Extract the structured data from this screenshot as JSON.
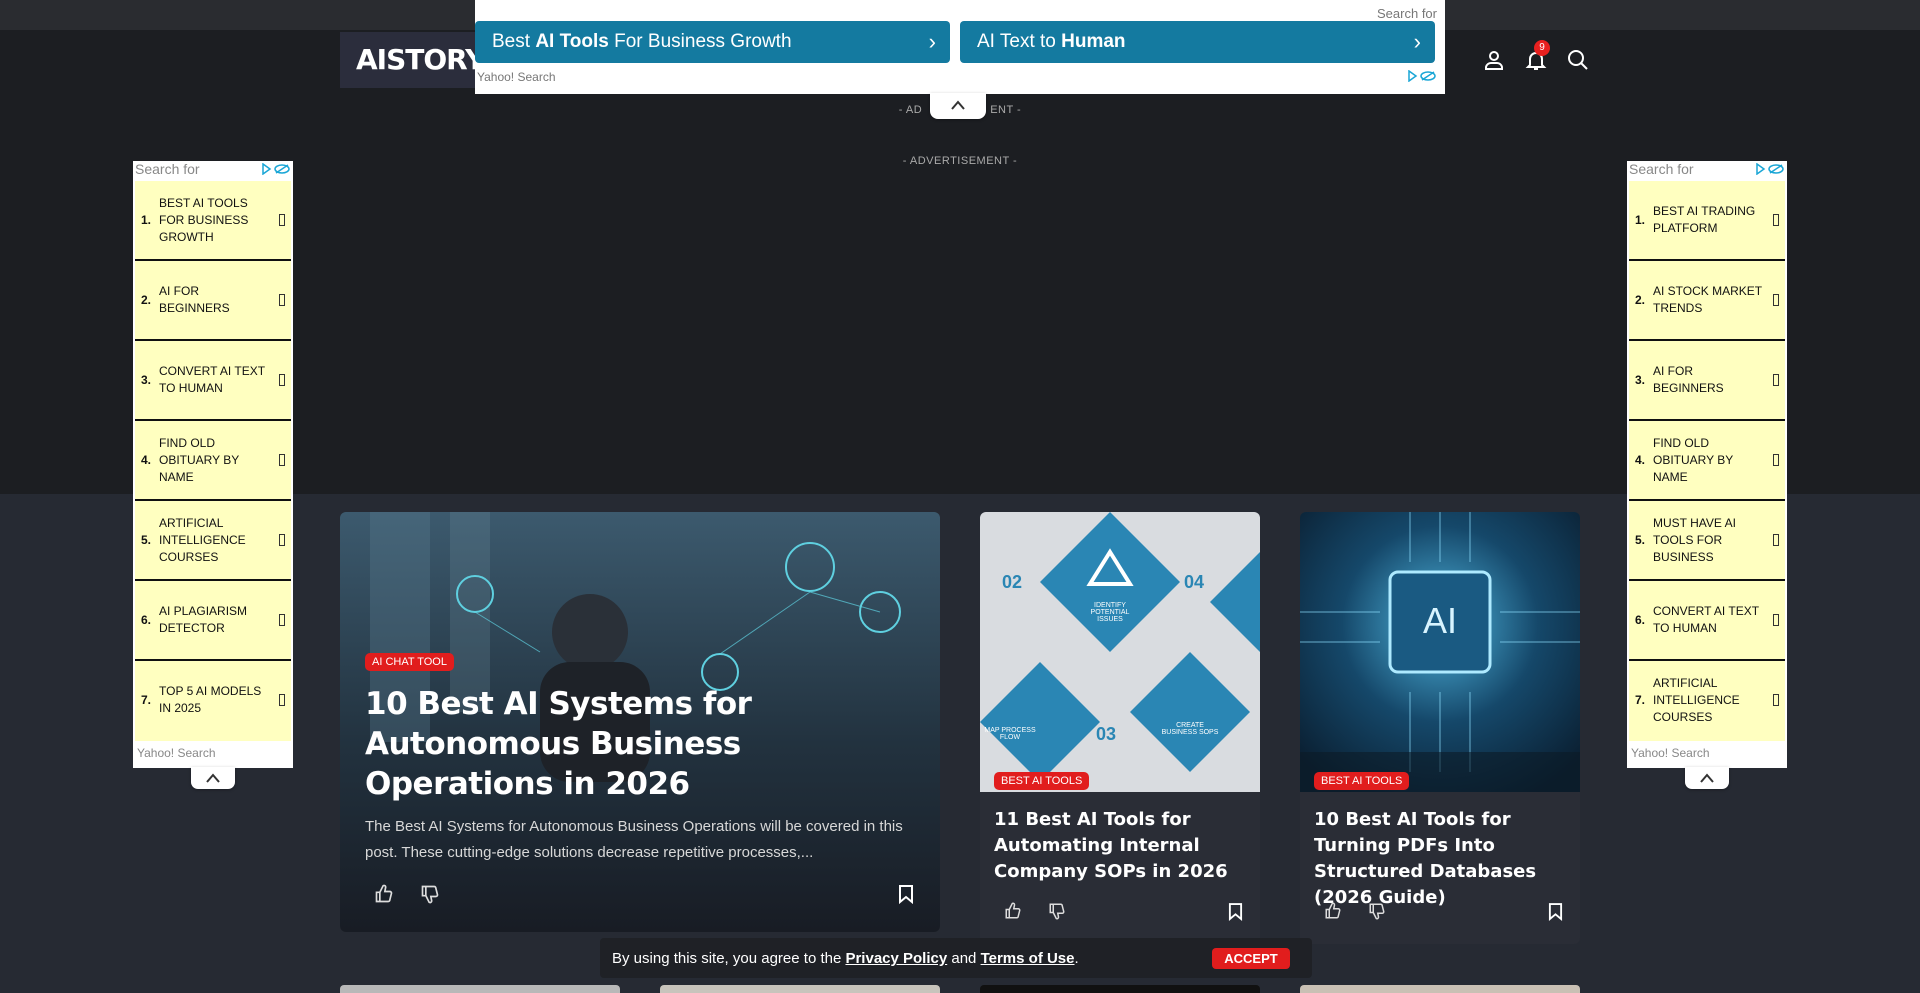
{
  "header": {
    "logo": "AISTORY",
    "notification_count": "9"
  },
  "top_ad": {
    "search_for": "Search for",
    "button1": {
      "pre": "Best ",
      "bold": "AI Tools",
      "post": " For Business Growth"
    },
    "button2": {
      "pre": "AI Text to ",
      "bold": "Human",
      "post": ""
    },
    "provider": "Yahoo! Search"
  },
  "advertisement_label": "- ADVERTISEMENT -",
  "advertisement_label_partial": "- AD",
  "advertisement_label_partial_end": "ENT -",
  "left_ad": {
    "search_for": "Search for",
    "provider": "Yahoo! Search",
    "items": [
      {
        "num": "1.",
        "label": "Best AI Tools For Business Growth"
      },
      {
        "num": "2.",
        "label": "AI For Beginners"
      },
      {
        "num": "3.",
        "label": "Convert AI Text To Human"
      },
      {
        "num": "4.",
        "label": "Find Old Obituary By Name"
      },
      {
        "num": "5.",
        "label": "Artificial Intelligence Courses"
      },
      {
        "num": "6.",
        "label": "AI Plagiarism Detector"
      },
      {
        "num": "7.",
        "label": "Top 5 AI Models In 2025"
      }
    ]
  },
  "right_ad": {
    "search_for": "Search for",
    "provider": "Yahoo! Search",
    "items": [
      {
        "num": "1.",
        "label": "Best AI Trading Platform"
      },
      {
        "num": "2.",
        "label": "AI Stock Market Trends"
      },
      {
        "num": "3.",
        "label": "AI For Beginners"
      },
      {
        "num": "4.",
        "label": "Find Old Obituary By Name"
      },
      {
        "num": "5.",
        "label": "Must Have AI Tools For Business"
      },
      {
        "num": "6.",
        "label": "Convert AI Text To Human"
      },
      {
        "num": "7.",
        "label": "Artificial Intelligence Courses"
      }
    ]
  },
  "featured": {
    "category": "AI CHAT TOOL",
    "title": "10 Best AI Systems for Autonomous Business Operations in 2026",
    "excerpt": "The Best AI Systems for Autonomous Business Operations will be covered in this post. These cutting-edge solutions decrease repetitive processes,..."
  },
  "card2": {
    "category": "BEST AI TOOLS",
    "title": "11 Best AI Tools for Automating Internal Company SOPs in 2026",
    "image_text": {
      "n1": "02",
      "n2": "04",
      "n3": "03",
      "t1": "IDENTIFY POTENTIAL ISSUES",
      "t2": "CREATE BUSINESS SOPS",
      "t3": "MAP PROCESS FLOW"
    }
  },
  "card3": {
    "category": "BEST AI TOOLS",
    "title": "10 Best AI Tools for Turning PDFs Into Structured Databases (2026 Guide)",
    "image_text": "AI"
  },
  "cookie": {
    "pre": "By using this site, you agree to the ",
    "privacy": "Privacy Policy",
    "and": " and ",
    "terms": "Terms of Use",
    "post": ".",
    "accept": "ACCEPT"
  },
  "colors": {
    "ad_blue": "#147aa0",
    "badge_red": "#e11d1d",
    "ad_item_bg": "#ffffc0",
    "page_bg": "#1c1e22"
  }
}
